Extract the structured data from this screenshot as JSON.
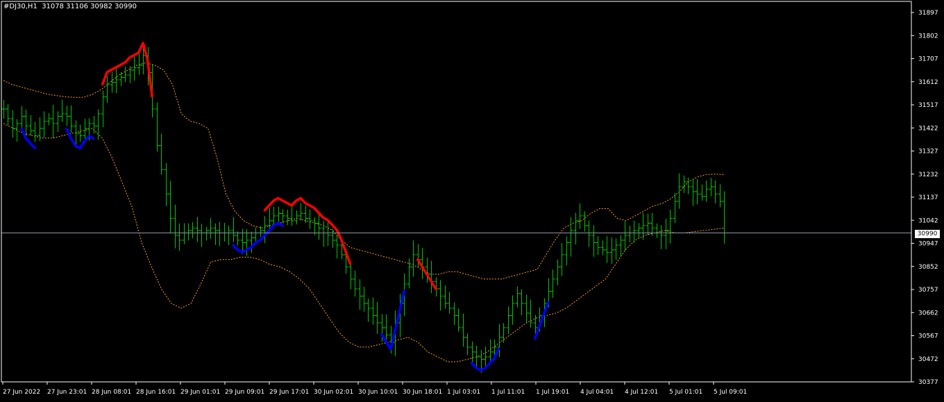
{
  "symbol_info": {
    "symbol": "#DJ30,H1",
    "ohlc": "31078 31106 30982 30990"
  },
  "current_price_label": "30990",
  "colors": {
    "background": "#000000",
    "bars": "#00c800",
    "bands": "#ff9e2c",
    "peak": "#ff0000",
    "trough": "#0000ff",
    "price_line": "#8a9aa8",
    "axis": "#ffffff"
  },
  "chart_data": {
    "type": "ohlc",
    "indicator": "bollinger-bands",
    "ylim": [
      30377,
      31897
    ],
    "yticks": [
      "31897",
      "31802",
      "31707",
      "31612",
      "31517",
      "31422",
      "31327",
      "31232",
      "31137",
      "31042",
      "30947",
      "30852",
      "30757",
      "30662",
      "30567",
      "30472",
      "30377"
    ],
    "xticks": [
      "27 Jun 2022",
      "27 Jun 23:01",
      "28 Jun 08:01",
      "28 Jun 16:01",
      "29 Jun 01:01",
      "29 Jun 09:01",
      "29 Jun 17:01",
      "30 Jun 02:01",
      "30 Jun 10:01",
      "30 Jun 18:01",
      "1 Jul 03:01",
      "1 Jul 11:01",
      "1 Jul 19:01",
      "4 Jul 04:01",
      "4 Jul 12:01",
      "5 Jul 01:01",
      "5 Jul 09:01"
    ],
    "bars_close": [
      31500,
      31460,
      31420,
      31440,
      31470,
      31430,
      31410,
      31390,
      31420,
      31450,
      31460,
      31440,
      31470,
      31480,
      31470,
      31430,
      31400,
      31390,
      31420,
      31440,
      31430,
      31480,
      31550,
      31600,
      31610,
      31620,
      31630,
      31640,
      31660,
      31670,
      31680,
      31720,
      31650,
      31500,
      31350,
      31250,
      31150,
      31050,
      30980,
      30960,
      30990,
      31000,
      31010,
      31000,
      30990,
      31000,
      31010,
      31000,
      30990,
      30990,
      31000,
      30980,
      30960,
      30950,
      30960,
      30970,
      30990,
      31000,
      31020,
      31040,
      31060,
      31070,
      31060,
      31050,
      31040,
      31060,
      31070,
      31050,
      31040,
      31030,
      31010,
      30990,
      30980,
      30960,
      30940,
      30900,
      30850,
      30800,
      30760,
      30730,
      30700,
      30680,
      30650,
      30620,
      30600,
      30570,
      30540,
      30620,
      30700,
      30780,
      30850,
      30900,
      30880,
      30850,
      30820,
      30790,
      30760,
      30730,
      30700,
      30680,
      30650,
      30600,
      30560,
      30520,
      30500,
      30480,
      30470,
      30480,
      30500,
      30520,
      30560,
      30600,
      30650,
      30700,
      30740,
      30700,
      30660,
      30620,
      30600,
      30650,
      30700,
      30750,
      30800,
      30850,
      30900,
      30950,
      31000,
      31040,
      31060,
      31020,
      30980,
      30950,
      30930,
      30920,
      30910,
      30920,
      30940,
      30960,
      30980,
      30990,
      31000,
      31010,
      31020,
      31030,
      31010,
      30990,
      30980,
      31000,
      31050,
      31120,
      31180,
      31200,
      31180,
      31160,
      31150,
      31140,
      31170,
      31180,
      31150,
      31120,
      30990
    ],
    "upper_band": [
      31617,
      31600,
      31590,
      31580,
      31570,
      31560,
      31555,
      31550,
      31548,
      31548,
      31560,
      31580,
      31610,
      31640,
      31660,
      31680,
      31690,
      31680,
      31660,
      31600,
      31480,
      31450,
      31440,
      31420,
      31300,
      31150,
      31080,
      31040,
      31020,
      31010,
      31020,
      31030,
      31040,
      31050,
      31040,
      31030,
      31020,
      31000,
      30960,
      30930,
      30920,
      30910,
      30900,
      30890,
      30880,
      30870,
      30860,
      30840,
      30820,
      30820,
      30830,
      30830,
      30820,
      30810,
      30800,
      30800,
      30800,
      30810,
      30820,
      30830,
      30840,
      30900,
      30960,
      31010,
      31030,
      31040,
      31070,
      31090,
      31090,
      31050,
      31040,
      31060,
      31080,
      31100,
      31110,
      31130,
      31160,
      31200,
      31220,
      31230,
      31232,
      31230
    ],
    "lower_band": [
      31440,
      31420,
      31400,
      31390,
      31380,
      31380,
      31390,
      31400,
      31410,
      31420,
      31380,
      31300,
      31200,
      31100,
      30950,
      30850,
      30760,
      30700,
      30680,
      30700,
      30780,
      30870,
      30880,
      30880,
      30890,
      30890,
      30880,
      30860,
      30850,
      30830,
      30800,
      30760,
      30700,
      30640,
      30580,
      30540,
      30520,
      30520,
      30530,
      30540,
      30550,
      30560,
      30540,
      30500,
      30480,
      30460,
      30460,
      30470,
      30480,
      30500,
      30530,
      30560,
      30590,
      30620,
      30640,
      30650,
      30660,
      30680,
      30710,
      30740,
      30770,
      30800,
      30860,
      30920,
      30960,
      30980,
      30990,
      31000,
      30990,
      30990,
      30995,
      31000,
      31005,
      31010
    ]
  }
}
